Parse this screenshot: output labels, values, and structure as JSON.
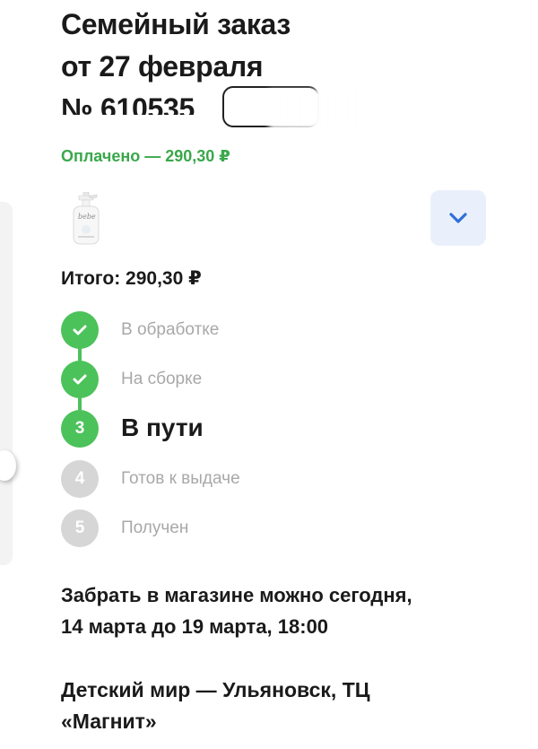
{
  "order": {
    "title_line1": "Семейный заказ",
    "title_line2": "от 27 февраля",
    "title_line3": "№ 610535",
    "paid_status": "Оплачено — 290,30 ₽",
    "total": "Итого: 290,30 ₽"
  },
  "product": {
    "thumb_icon": "soap-bottle-icon",
    "expand_icon": "chevron-down-icon"
  },
  "steps": [
    {
      "num": "",
      "label": "В обработке",
      "state": "done",
      "icon": "check-icon"
    },
    {
      "num": "",
      "label": "На сборке",
      "state": "done",
      "icon": "check-icon"
    },
    {
      "num": "3",
      "label": "В пути",
      "state": "active"
    },
    {
      "num": "4",
      "label": "Готов к выдаче",
      "state": "pending"
    },
    {
      "num": "5",
      "label": "Получен",
      "state": "pending"
    }
  ],
  "pickup": {
    "line1": "Забрать в магазине можно сегодня,",
    "line2": "14 марта до 19 марта, 18:00"
  },
  "store": {
    "line1": "Детский мир — Ульяновск, ТЦ",
    "line2": "«Магнит»"
  },
  "colors": {
    "accent_green": "#4cc25a",
    "paid_green": "#3aa84b",
    "pending_gray": "#d6d6d6",
    "button_bg": "#eaf0fb",
    "chevron_blue": "#2f6fd8"
  }
}
